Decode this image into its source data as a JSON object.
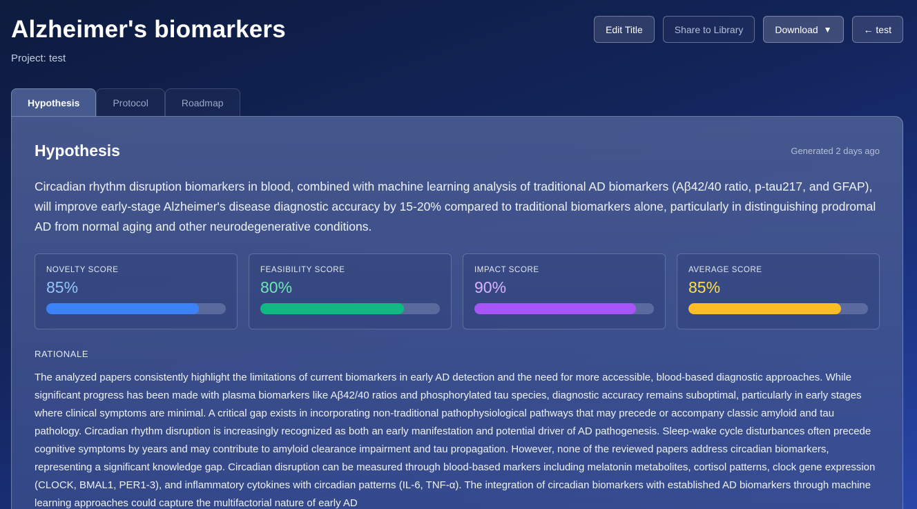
{
  "page": {
    "title": "Alzheimer's biomarkers",
    "project": "Project: test"
  },
  "actions": {
    "edit_title": "Edit Title",
    "share": "Share to Library",
    "download": "Download",
    "download_caret": "▼",
    "back": "← test"
  },
  "tabs": [
    {
      "label": "Hypothesis",
      "active": true
    },
    {
      "label": "Protocol",
      "active": false
    },
    {
      "label": "Roadmap",
      "active": false
    }
  ],
  "card": {
    "title": "Hypothesis",
    "generated": "Generated 2 days ago",
    "hypothesis_text": "Circadian rhythm disruption biomarkers in blood, combined with machine learning analysis of traditional AD biomarkers (Aβ42/40 ratio, p-tau217, and GFAP), will improve early-stage Alzheimer's disease diagnostic accuracy by 15-20% compared to traditional biomarkers alone, particularly in distinguishing prodromal AD from normal aging and other neurodegenerative conditions."
  },
  "scores": [
    {
      "label": "NOVELTY SCORE",
      "value": "85%",
      "fraction": 0.85,
      "color": "#3b82f6",
      "text_color": "#93c5fd"
    },
    {
      "label": "FEASIBILITY SCORE",
      "value": "80%",
      "fraction": 0.8,
      "color": "#10b981",
      "text_color": "#6ee7b7"
    },
    {
      "label": "IMPACT SCORE",
      "value": "90%",
      "fraction": 0.9,
      "color": "#a855f7",
      "text_color": "#d8b4fe"
    },
    {
      "label": "AVERAGE SCORE",
      "value": "85%",
      "fraction": 0.85,
      "color": "#fbbf24",
      "text_color": "#fde047"
    }
  ],
  "rationale": {
    "title": "RATIONALE",
    "text": "The analyzed papers consistently highlight the limitations of current biomarkers in early AD detection and the need for more accessible, blood-based diagnostic approaches. While significant progress has been made with plasma biomarkers like Aβ42/40 ratios and phosphorylated tau species, diagnostic accuracy remains suboptimal, particularly in early stages where clinical symptoms are minimal. A critical gap exists in incorporating non-traditional pathophysiological pathways that may precede or accompany classic amyloid and tau pathology. Circadian rhythm disruption is increasingly recognized as both an early manifestation and potential driver of AD pathogenesis. Sleep-wake cycle disturbances often precede cognitive symptoms by years and may contribute to amyloid clearance impairment and tau propagation. However, none of the reviewed papers address circadian biomarkers, representing a significant knowledge gap. Circadian disruption can be measured through blood-based markers including melatonin metabolites, cortisol patterns, clock gene expression (CLOCK, BMAL1, PER1-3), and inflammatory cytokines with circadian patterns (IL-6, TNF-α). The integration of circadian biomarkers with established AD biomarkers through machine learning approaches could capture the multifactorial nature of early AD"
  }
}
